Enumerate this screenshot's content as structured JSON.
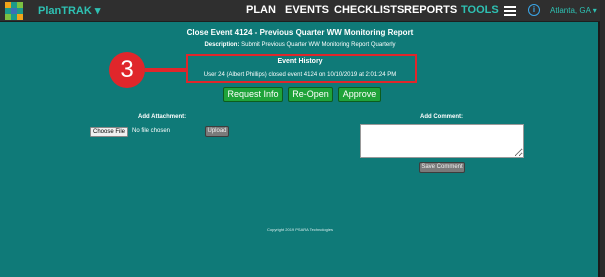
{
  "navbar": {
    "brand": "PlanTRAK",
    "brand_caret": "▾",
    "items": [
      "PLAN",
      "EVENTS",
      "CHECKLISTS",
      "REPORTS",
      "TOOLS"
    ],
    "active_item": "TOOLS",
    "location": "Atlanta, GA",
    "location_caret": "▾",
    "icons": [
      "logo-icon",
      "hamburger-menu-icon",
      "info-icon"
    ]
  },
  "page": {
    "title": "Close Event 4124 - Previous Quarter WW Monitoring Report",
    "description_label": "Description:",
    "description_value": "Submit Previous Quarter WW Monitoring Report Quarterly"
  },
  "history": {
    "title": "Event History",
    "entry": "User 24 (Albert Phillips) closed event 4124 on 10/10/2019 at 2:01:24 PM"
  },
  "annotation": {
    "step_number": "3",
    "color": "#e0262b"
  },
  "actions": {
    "request_info": "Request Info",
    "reopen": "Re-Open",
    "approve": "Approve"
  },
  "attachment": {
    "label": "Add Attachment:",
    "choose_file": "Choose File",
    "file_status": "No file chosen",
    "upload": "Upload"
  },
  "comment": {
    "label": "Add Comment:",
    "value": "",
    "save": "Save Comment"
  },
  "footer": {
    "copyright": "Copyright 2019 PSARA Technologies"
  },
  "colors": {
    "background": "#0f7a78",
    "navbar": "#2f2f2f",
    "accent_teal": "#2ec1b3",
    "action_green": "#1fa33a",
    "annotation_red": "#e0262b"
  }
}
